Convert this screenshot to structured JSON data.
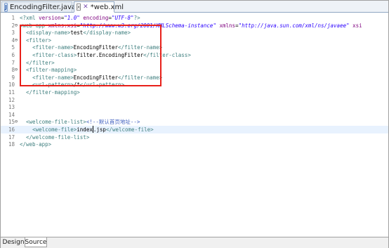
{
  "tabs": [
    {
      "label": "EncodingFilter.java",
      "icon": "java-file-icon",
      "active": false
    },
    {
      "label": "*web.xml",
      "icon": "xml-file-icon",
      "active": true,
      "close": "x"
    }
  ],
  "gutter": {
    "fold_markers": {
      "2": "⊖",
      "4": "⊖",
      "8": "⊖",
      "15": "⊖"
    }
  },
  "editor": {
    "lines": [
      {
        "n": "1",
        "parts": [
          [
            "tag",
            "<?xml "
          ],
          [
            "attr",
            "version"
          ],
          [
            "txt",
            "="
          ],
          [
            "val",
            "\"1.0\""
          ],
          [
            "txt",
            " "
          ],
          [
            "attr",
            "encoding"
          ],
          [
            "txt",
            "="
          ],
          [
            "val",
            "\"UTF-8\""
          ],
          [
            "tag",
            "?>"
          ]
        ]
      },
      {
        "n": "2",
        "parts": [
          [
            "tag",
            "<web-app "
          ],
          [
            "attr",
            "xmlns:xsi"
          ],
          [
            "txt",
            "="
          ],
          [
            "val",
            "\"http://www.w3.org/2001/XMLSchema-instance\""
          ],
          [
            "txt",
            " "
          ],
          [
            "attr",
            "xmlns"
          ],
          [
            "txt",
            "="
          ],
          [
            "val",
            "\"http://java.sun.com/xml/ns/javaee\""
          ],
          [
            "txt",
            " "
          ],
          [
            "attr",
            "xsi"
          ]
        ]
      },
      {
        "n": "3",
        "parts": [
          [
            "txt",
            "  "
          ],
          [
            "tag",
            "<display-name>"
          ],
          [
            "txt",
            "test"
          ],
          [
            "tag",
            "</display-name>"
          ]
        ]
      },
      {
        "n": "4",
        "parts": [
          [
            "txt",
            "  "
          ],
          [
            "tag",
            "<filter>"
          ]
        ]
      },
      {
        "n": "5",
        "parts": [
          [
            "txt",
            "    "
          ],
          [
            "tag",
            "<filter-name>"
          ],
          [
            "txt",
            "EncodingFilter"
          ],
          [
            "tag",
            "</filter-name>"
          ]
        ]
      },
      {
        "n": "6",
        "parts": [
          [
            "txt",
            "    "
          ],
          [
            "tag",
            "<filter-class>"
          ],
          [
            "txt",
            "filter.EncodingFilter"
          ],
          [
            "tag",
            "</filter-class>"
          ]
        ]
      },
      {
        "n": "7",
        "parts": [
          [
            "txt",
            "  "
          ],
          [
            "tag",
            "</filter>"
          ]
        ]
      },
      {
        "n": "8",
        "parts": [
          [
            "txt",
            "  "
          ],
          [
            "tag",
            "<filter-mapping>"
          ]
        ]
      },
      {
        "n": "9",
        "parts": [
          [
            "txt",
            "    "
          ],
          [
            "tag",
            "<filter-name>"
          ],
          [
            "txt",
            "EncodingFilter"
          ],
          [
            "tag",
            "</filter-name>"
          ]
        ]
      },
      {
        "n": "10",
        "parts": [
          [
            "txt",
            "    "
          ],
          [
            "tag",
            "<url-pattern>"
          ],
          [
            "txt",
            "/*"
          ],
          [
            "tag",
            "</url-pattern>"
          ]
        ]
      },
      {
        "n": "11",
        "parts": [
          [
            "txt",
            "  "
          ],
          [
            "tag",
            "</filter-mapping>"
          ]
        ]
      },
      {
        "n": "12",
        "parts": []
      },
      {
        "n": "13",
        "parts": []
      },
      {
        "n": "14",
        "parts": []
      },
      {
        "n": "15",
        "parts": [
          [
            "txt",
            "  "
          ],
          [
            "tag",
            "<welcome-file-list>"
          ],
          [
            "com",
            "<!--默认首页地址-->"
          ]
        ]
      },
      {
        "n": "16",
        "parts": [
          [
            "txt",
            "    "
          ],
          [
            "tag",
            "<welcome-file>"
          ],
          [
            "txt",
            "index"
          ],
          [
            "caret",
            ""
          ],
          [
            "txt",
            ".jsp"
          ],
          [
            "tag",
            "</welcome-file>"
          ]
        ],
        "current": true
      },
      {
        "n": "17",
        "parts": [
          [
            "txt",
            "  "
          ],
          [
            "tag",
            "</welcome-file-list>"
          ]
        ]
      },
      {
        "n": "18",
        "parts": [
          [
            "tag",
            "</web-app>"
          ]
        ]
      }
    ]
  },
  "bottom_tabs": [
    {
      "label": "Design",
      "active": false
    },
    {
      "label": "Source",
      "active": true
    }
  ],
  "colors": {
    "tag": "#3f7f7f",
    "attr": "#7f007f",
    "value": "#2a00ff",
    "comment": "#3f5fbf",
    "annotation": "#e8201a"
  }
}
